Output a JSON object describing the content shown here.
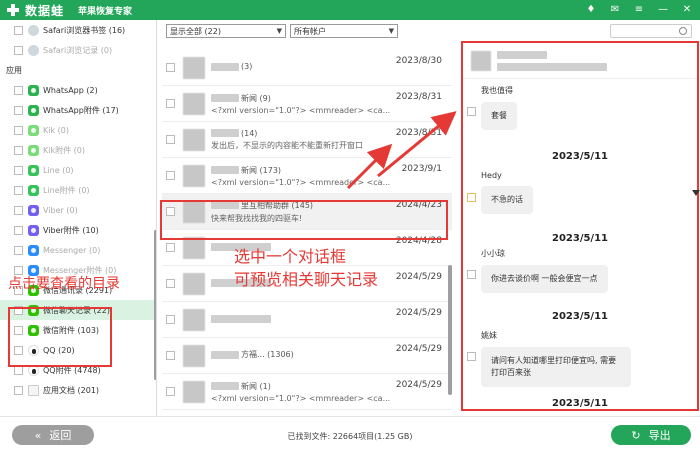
{
  "titlebar": {
    "app_name": "数据蛙",
    "subtitle": "苹果恢复专家",
    "controls": [
      "♦",
      "✉",
      "≡",
      "—",
      "✕"
    ]
  },
  "sidebar": {
    "top_items": [
      {
        "label": "Safari浏览器书签 (16)",
        "dim": false
      },
      {
        "label": "Safari浏览记录 (0)",
        "dim": true
      }
    ],
    "section_label": "应用",
    "app_items": [
      {
        "label": "WhatsApp (2)",
        "icon": "whatsapp-icon",
        "dim": false
      },
      {
        "label": "WhatsApp附件 (17)",
        "icon": "whatsapp-icon",
        "dim": false
      },
      {
        "label": "Kik (0)",
        "icon": "kik-icon",
        "dim": true
      },
      {
        "label": "Kik附件 (0)",
        "icon": "kik-icon",
        "dim": true
      },
      {
        "label": "Line (0)",
        "icon": "line-icon",
        "dim": true
      },
      {
        "label": "Line附件 (0)",
        "icon": "line-icon",
        "dim": true
      },
      {
        "label": "Viber (0)",
        "icon": "viber-icon",
        "dim": true
      },
      {
        "label": "Viber附件 (10)",
        "icon": "viber-icon",
        "dim": false
      },
      {
        "label": "Messenger (0)",
        "icon": "messenger-icon",
        "dim": true
      },
      {
        "label": "Messenger附件 (0)",
        "icon": "messenger-icon",
        "dim": true
      },
      {
        "label": "微信通讯录 (2291)",
        "icon": "wechat-icon",
        "dim": false
      },
      {
        "label": "微信聊天记录 (22)",
        "icon": "wechat-icon",
        "dim": false,
        "selected": true
      },
      {
        "label": "微信附件 (103)",
        "icon": "wechat-icon",
        "dim": false
      },
      {
        "label": "QQ (20)",
        "icon": "qq-icon",
        "dim": false
      },
      {
        "label": "QQ附件 (4748)",
        "icon": "qq-icon",
        "dim": false
      },
      {
        "label": "应用文档 (201)",
        "icon": "document-icon",
        "dim": false
      }
    ]
  },
  "annotations": {
    "left": "点击要查看的目录",
    "middle_line1": "选中一个对话框",
    "middle_line2": "可预览相关聊天记录"
  },
  "filters": {
    "show_all": "显示全部 (22)",
    "accounts": "所有帐户"
  },
  "messages": [
    {
      "title": "(3)",
      "preview": "",
      "date": "2023/8/30"
    },
    {
      "title": "新闻 (9)",
      "preview": "<?xml version=\"1.0\"?> <mmreader> <ca...",
      "date": "2023/8/31"
    },
    {
      "title": "(14)",
      "preview": "发出后，不显示的内容能不能重新打开窗口",
      "date": "2023/8/31"
    },
    {
      "title": "新闻 (173)",
      "preview": "<?xml version=\"1.0\"?> <mmreader> <ca...",
      "date": "2023/9/1"
    },
    {
      "title": "里互相帮助群 (145)",
      "preview": "快来帮我找找我的四驱车!",
      "date": "2024/4/23",
      "active": true
    },
    {
      "title": "",
      "preview": "",
      "date": "2024/4/28"
    },
    {
      "title": "",
      "preview": "",
      "date": "2024/5/29"
    },
    {
      "title": "",
      "preview": "",
      "date": "2024/5/29"
    },
    {
      "title": "方福... (1306)",
      "preview": "",
      "date": "2024/5/29"
    },
    {
      "title": "新闻 (1)",
      "preview": "<?xml version=\"1.0\"?> <mmreader> <ca...",
      "date": "2024/5/29"
    },
    {
      "title": "",
      "preview": "",
      "date": "2024/5/29"
    }
  ],
  "chat": {
    "messages": [
      {
        "sender": "我也值得",
        "text": "套餐"
      },
      {
        "date": "2023/5/11"
      },
      {
        "sender": "Hedy",
        "text": "不急的话"
      },
      {
        "date": "2023/5/11"
      },
      {
        "sender": "小小琼",
        "text": "你进去谈价啊 一般会便宜一点"
      },
      {
        "date": "2023/5/11"
      },
      {
        "sender": "姚妹",
        "text": "请问有人知道哪里打印便宜吗, 需要打印百来张"
      },
      {
        "date": "2023/5/11"
      }
    ]
  },
  "footer": {
    "back_label": "返回",
    "status": "已找到文件: 22664项目(1.25 GB)",
    "export_label": "导出"
  },
  "colors": {
    "brand_green": "#23a65a",
    "annotation_red": "#e53935"
  }
}
